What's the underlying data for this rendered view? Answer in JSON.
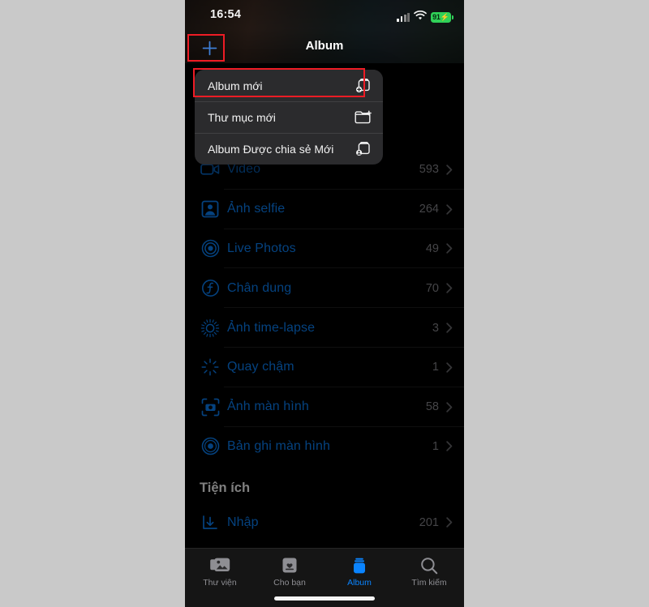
{
  "background_color": "#c9c9c9",
  "status_bar": {
    "time": "16:54",
    "signal_icon": "cellular-signal-icon",
    "wifi_icon": "wifi-icon",
    "battery_percent": "91",
    "battery_charging_glyph": "⚡",
    "battery_color": "#30d158"
  },
  "nav": {
    "title": "Album",
    "add_button_icon": "plus-icon",
    "accent_color": "#0a84ff"
  },
  "context_menu": {
    "items": [
      {
        "label": "Album mới",
        "icon": "new-album-icon",
        "selected": true
      },
      {
        "label": "Thư mục mới",
        "icon": "new-folder-icon",
        "selected": false
      },
      {
        "label": "Album Được chia sẻ Mới",
        "icon": "new-shared-album-icon",
        "selected": false
      }
    ]
  },
  "annotations": {
    "highlight_color": "#ee1c25",
    "boxes": [
      "add-button",
      "new-album-menu-item"
    ]
  },
  "album_list": {
    "rows": [
      {
        "label": "Video",
        "count": "593",
        "icon": "video-camera-icon"
      },
      {
        "label": "Ảnh selfie",
        "count": "264",
        "icon": "selfie-person-icon"
      },
      {
        "label": "Live Photos",
        "count": "49",
        "icon": "live-photo-icon"
      },
      {
        "label": "Chân dung",
        "count": "70",
        "icon": "portrait-f-icon"
      },
      {
        "label": "Ảnh time-lapse",
        "count": "3",
        "icon": "timelapse-icon"
      },
      {
        "label": "Quay chậm",
        "count": "1",
        "icon": "slomo-icon"
      },
      {
        "label": "Ảnh màn hình",
        "count": "58",
        "icon": "screenshot-icon"
      },
      {
        "label": "Bản ghi màn hình",
        "count": "1",
        "icon": "screen-recording-icon"
      }
    ],
    "section_title": "Tiện ích",
    "utility_rows": [
      {
        "label": "Nhập",
        "count": "201",
        "icon": "import-icon"
      }
    ],
    "chevron_icon": "chevron-right-icon"
  },
  "tab_bar": {
    "tabs": [
      {
        "label": "Thư viện",
        "icon": "photos-library-icon",
        "active": false
      },
      {
        "label": "Cho bạn",
        "icon": "for-you-icon",
        "active": false
      },
      {
        "label": "Album",
        "icon": "albums-icon",
        "active": true
      },
      {
        "label": "Tìm kiếm",
        "icon": "search-icon",
        "active": false
      }
    ],
    "active_color": "#0a84ff",
    "inactive_color": "#8e8e93"
  }
}
